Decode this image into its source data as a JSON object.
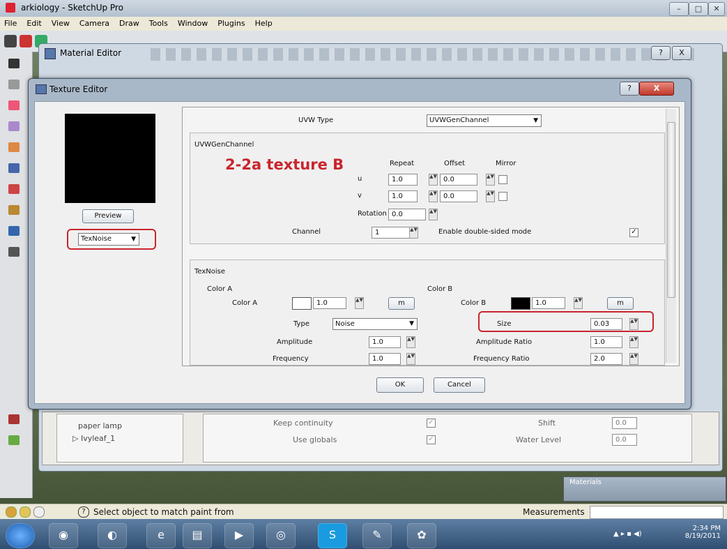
{
  "app": {
    "title": "arkiology - SketchUp Pro"
  },
  "menu": [
    "File",
    "Edit",
    "View",
    "Camera",
    "Draw",
    "Tools",
    "Window",
    "Plugins",
    "Help"
  ],
  "material_editor": {
    "title": "Material Editor",
    "list_items": [
      "paper lamp",
      "▷ Ivyleaf_1"
    ],
    "rows": [
      {
        "label": "Keep continuity",
        "right_label": "Shift",
        "right_value": "0.0"
      },
      {
        "label": "Use globals",
        "right_label": "Water Level",
        "right_value": "0.0"
      }
    ]
  },
  "texture_editor": {
    "title": "Texture Editor",
    "preview_label": "Preview",
    "texture_type": "TexNoise",
    "help_glyph": "?",
    "close_glyph": "X",
    "annotation": "2-2a texture B",
    "uvw": {
      "type_label": "UVW Type",
      "type_value": "UVWGenChannel",
      "group_label": "UVWGenChannel",
      "repeat_header": "Repeat",
      "offset_header": "Offset",
      "mirror_header": "Mirror",
      "u_label": "u",
      "v_label": "v",
      "u_repeat": "1.0",
      "u_offset": "0.0",
      "v_repeat": "1.0",
      "v_offset": "0.0",
      "rotation_label": "Rotation",
      "rotation": "0.0",
      "channel_label": "Channel",
      "channel": "1",
      "double_sided_label": "Enable double-sided mode"
    },
    "texnoise": {
      "group_label": "TexNoise",
      "color_a_group": "Color A",
      "color_a_label": "Color A",
      "color_a_value": "1.0",
      "color_a_btn": "m",
      "color_b_group": "Color B",
      "color_b_label": "Color B",
      "color_b_value": "1.0",
      "color_b_btn": "m",
      "type_label": "Type",
      "type_value": "Noise",
      "size_label": "Size",
      "size_value": "0.03",
      "amplitude_label": "Amplitude",
      "amplitude_value": "1.0",
      "amp_ratio_label": "Amplitude Ratio",
      "amp_ratio_value": "1.0",
      "frequency_label": "Frequency",
      "frequency_value": "1.0",
      "freq_ratio_label": "Frequency Ratio",
      "freq_ratio_value": "2.0"
    },
    "ok": "OK",
    "cancel": "Cancel"
  },
  "status": {
    "hint": "Select object to match paint from",
    "measurements": "Measurements"
  },
  "materials_tray": "Materials",
  "clock": {
    "time": "2:34 PM",
    "date": "8/19/2011"
  },
  "colors": {
    "annotation_red": "#c9252d",
    "preview_black": "#000000",
    "color_a": "#ffffff",
    "color_b": "#000000"
  }
}
